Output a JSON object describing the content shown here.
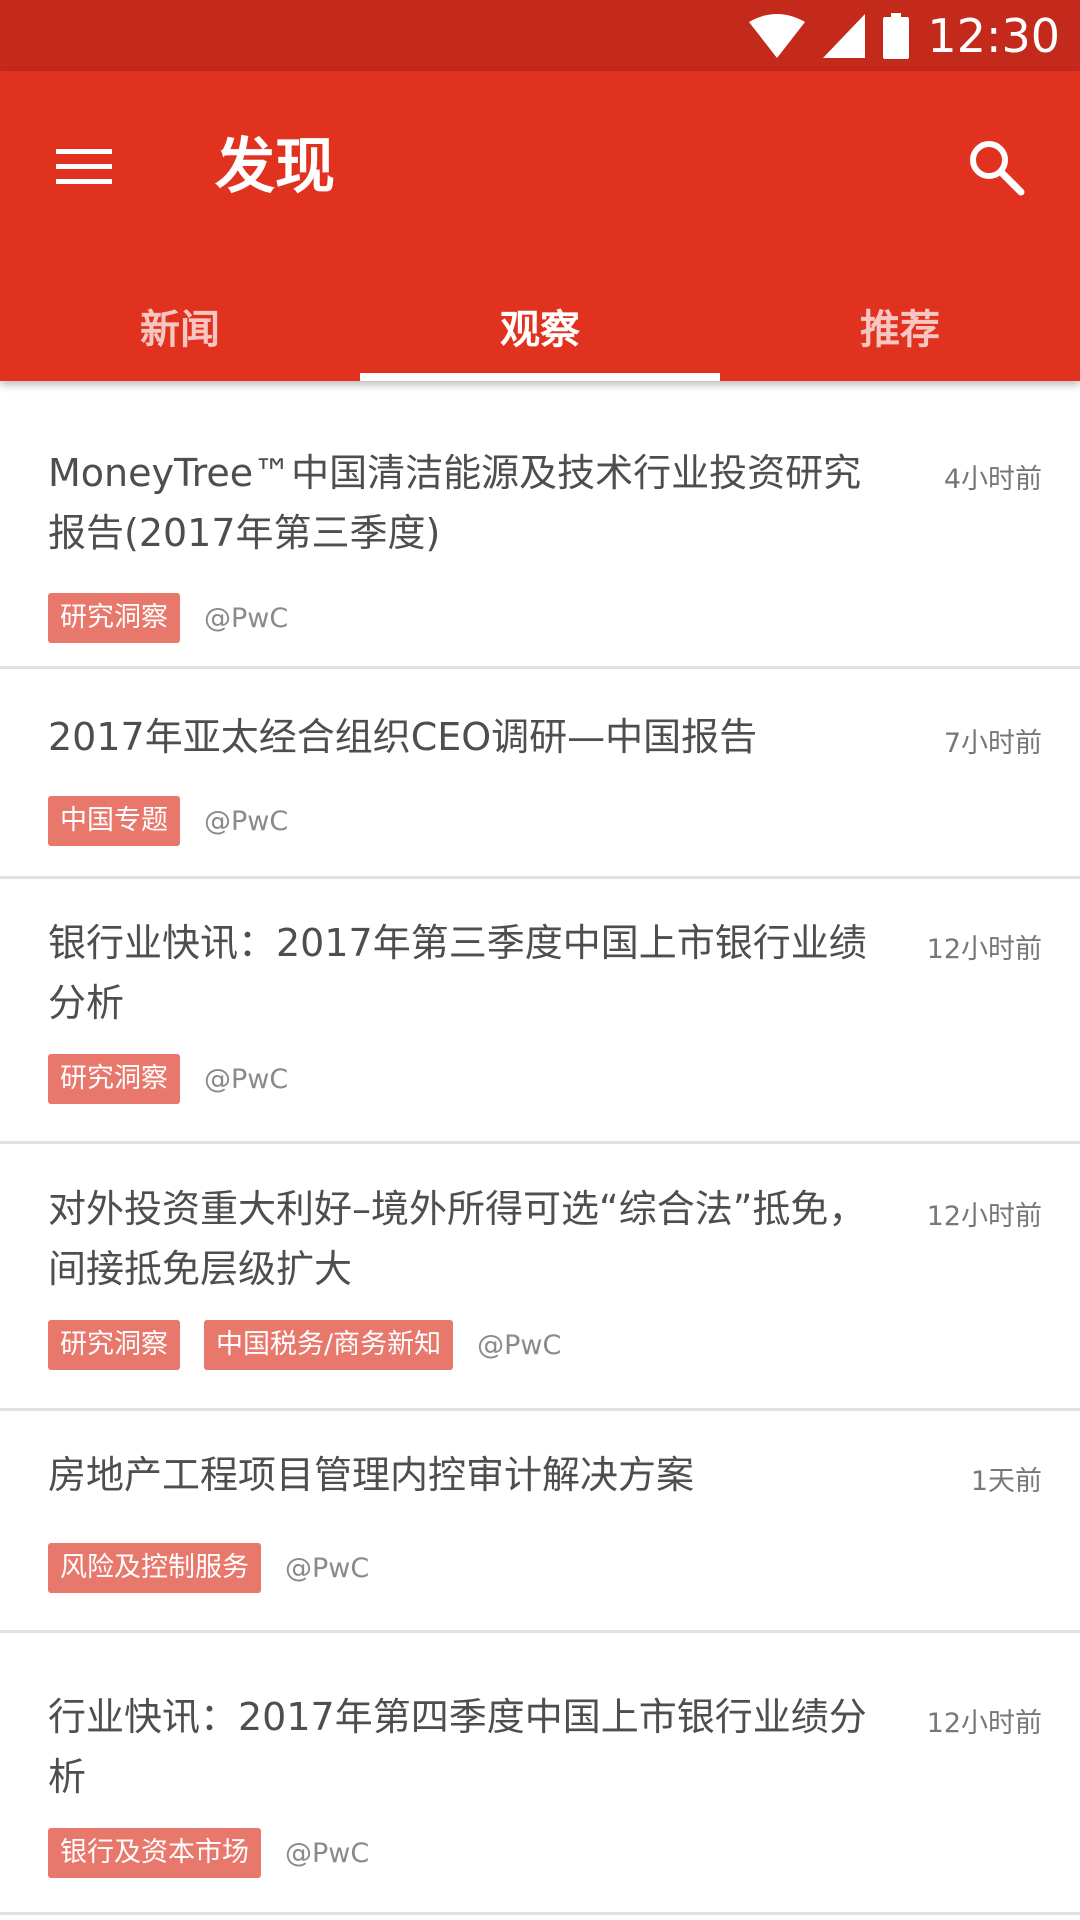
{
  "status_bar": {
    "time": "12:30",
    "icons": [
      "wifi-icon",
      "signal-icon",
      "battery-icon"
    ]
  },
  "app_bar": {
    "title": "发现",
    "menu_icon": "menu-icon",
    "search_icon": "search-icon"
  },
  "tabs": [
    {
      "label": "新闻",
      "active": false
    },
    {
      "label": "观察",
      "active": true
    },
    {
      "label": "推荐",
      "active": false
    }
  ],
  "items": [
    {
      "title": "MoneyTree™中国清洁能源及技术行业投资研究报告(2017年第三季度)",
      "time": "4小时前",
      "tags": [
        "研究洞察"
      ],
      "source": "@PwC"
    },
    {
      "title": "2017年亚太经合组织CEO调研—中国报告",
      "time": "7小时前",
      "tags": [
        "中国专题"
      ],
      "source": "@PwC"
    },
    {
      "title": "银行业快讯：2017年第三季度中国上市银行业绩分析",
      "time": "12小时前",
      "tags": [
        "研究洞察"
      ],
      "source": "@PwC"
    },
    {
      "title": "对外投资重大利好–境外所得可选“综合法”抵免，间接抵免层级扩大",
      "time": "12小时前",
      "tags": [
        "研究洞察",
        "中国税务/商务新知"
      ],
      "source": "@PwC"
    },
    {
      "title": "房地产工程项目管理内控审计解决方案",
      "time": "1天前",
      "tags": [
        "风险及控制服务"
      ],
      "source": "@PwC"
    },
    {
      "title": "行业快讯：2017年第四季度中国上市银行业绩分析",
      "time": "12小时前",
      "tags": [
        "银行及资本市场"
      ],
      "source": "@PwC"
    }
  ],
  "colors": {
    "status_bar": "#c42a1c",
    "app_bar": "#e0321f",
    "tag": "#e8776c"
  }
}
